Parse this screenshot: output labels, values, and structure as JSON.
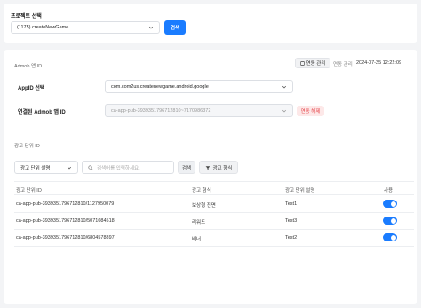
{
  "project": {
    "label": "프로젝트 선택",
    "selected": "(1175) createNewGame",
    "search_button": "검색"
  },
  "admob": {
    "section_label": "Admob 앱 ID",
    "link_manage_button": "연동 관리",
    "link_time_label": "연동 관리",
    "link_time_value": "2024-07-25 12:22:09",
    "appid_label": "AppID 선택",
    "appid_selected": "com.com2us.createnewgame.android.google",
    "linked_label": "연결된 Admob 앱 ID",
    "linked_value": "ca-app-pub-3939351796712810~7170986372",
    "unlink_button": "연동 해제"
  },
  "adunit": {
    "section_label": "광고 단위 ID",
    "filter_select": "광고 단위 설명",
    "search_placeholder": "검색어를 입력하세요.",
    "search_button": "검색",
    "format_button": "광고 형식",
    "columns": [
      "광고 단위 ID",
      "광고 형식",
      "광고 단위 설명",
      "사용"
    ],
    "rows": [
      {
        "id": "ca-app-pub-3939351796712810/1127950079",
        "format": "보상형 전면",
        "desc": "Test1",
        "enabled": true
      },
      {
        "id": "ca-app-pub-3939351796712810/5071084518",
        "format": "리워드",
        "desc": "Test3",
        "enabled": true
      },
      {
        "id": "ca-app-pub-3939351796712810/6804578897",
        "format": "배너",
        "desc": "Test2",
        "enabled": true
      }
    ]
  },
  "colors": {
    "accent": "#1a7cff",
    "danger": "#e5484d"
  }
}
